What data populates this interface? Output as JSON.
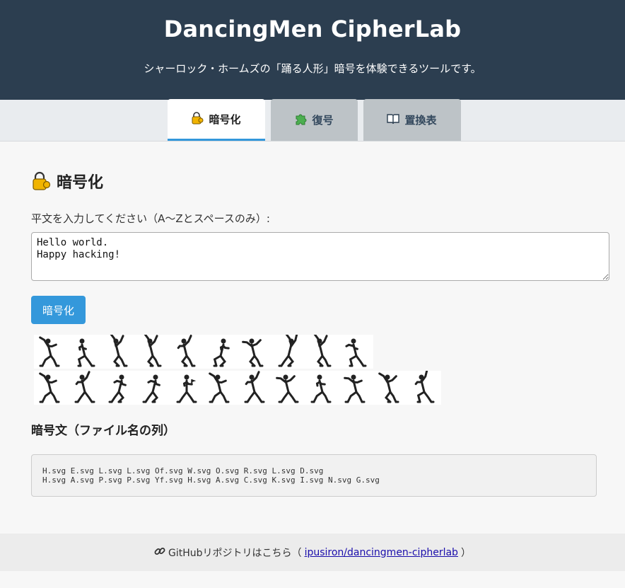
{
  "header": {
    "title": "DancingMen CipherLab",
    "subtitle": "シャーロック・ホームズの「踊る人形」暗号を体験できるツールです。"
  },
  "tabs": [
    {
      "label": "暗号化",
      "icon": "lock-with-key-icon",
      "active": true
    },
    {
      "label": "復号",
      "icon": "puzzle-icon",
      "active": false
    },
    {
      "label": "置換表",
      "icon": "book-icon",
      "active": false
    }
  ],
  "encrypt": {
    "section_title": "暗号化",
    "input_label": "平文を入力してください（A〜Zとスペースのみ）:",
    "input_value": "Hello world.\nHappy hacking!",
    "button_label": "暗号化",
    "figures": [
      [
        "H",
        "E",
        "L",
        "L",
        "Of",
        "W",
        "O",
        "R",
        "L",
        "D"
      ],
      [
        "H",
        "A",
        "P",
        "P",
        "Yf",
        "H",
        "A",
        "C",
        "K",
        "I",
        "N",
        "G"
      ]
    ],
    "cipher_title": "暗号文（ファイル名の列）",
    "cipher_text": "H.svg E.svg L.svg L.svg Of.svg W.svg O.svg R.svg L.svg D.svg\nH.svg A.svg P.svg P.svg Yf.svg H.svg A.svg C.svg K.svg I.svg N.svg G.svg"
  },
  "footer": {
    "icon": "link-icon",
    "prefix": "GitHubリポジトリはこちら（",
    "link_text": "ipusiron/dancingmen-cipherlab",
    "suffix": "）"
  },
  "colors": {
    "header_bg": "#2c3e50",
    "accent": "#3498db",
    "tab_inactive": "#bdc3c7"
  }
}
